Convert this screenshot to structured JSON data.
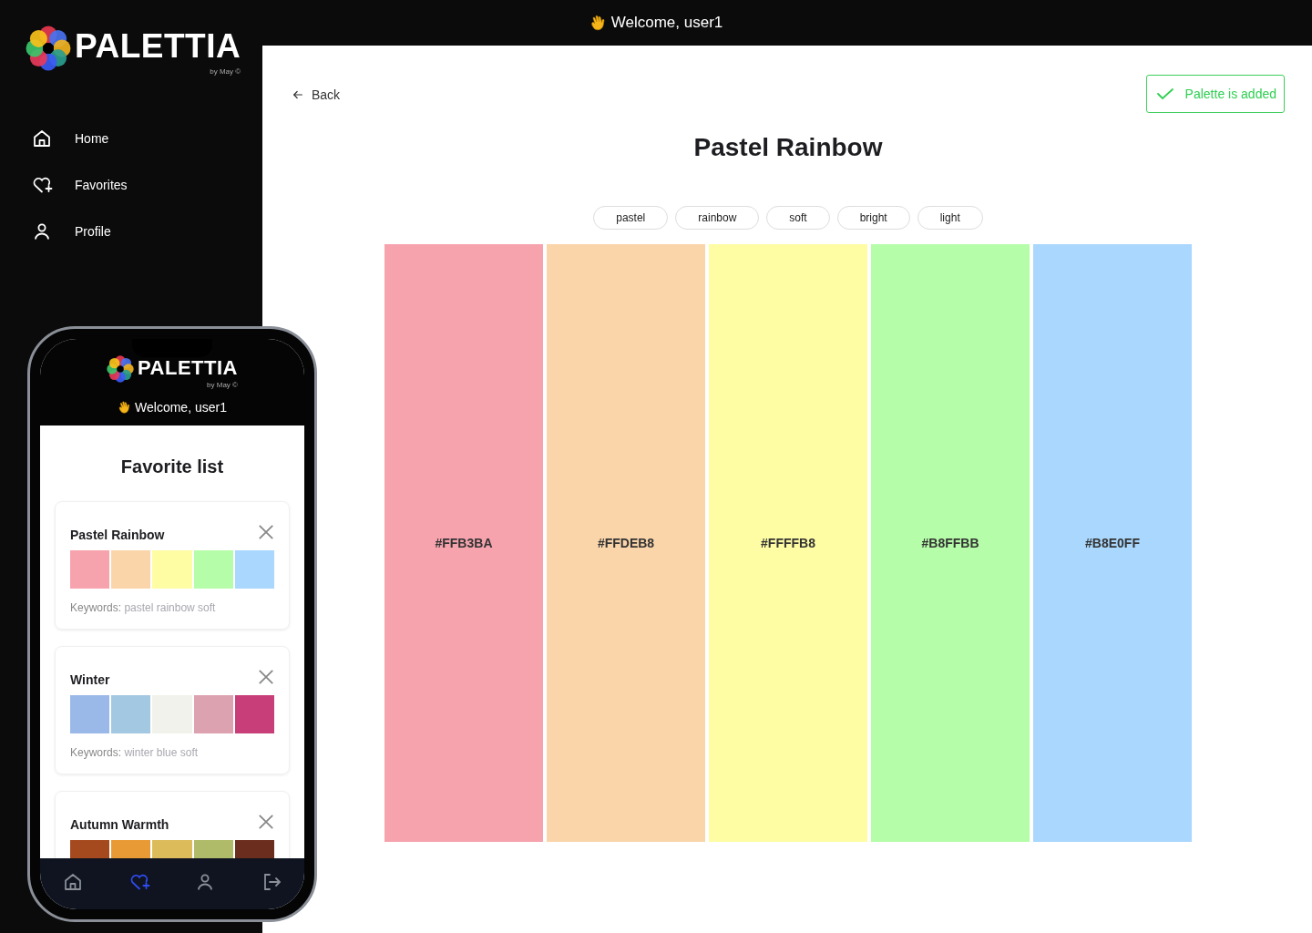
{
  "brand": {
    "name": "PALETTIA",
    "byline": "by May ©"
  },
  "sidebar": {
    "items": [
      {
        "label": "Home",
        "selected": false
      },
      {
        "label": "Favorites",
        "selected": false
      },
      {
        "label": "Profile",
        "selected": false
      }
    ]
  },
  "topbar": {
    "welcome": "Welcome, user1"
  },
  "main": {
    "back": "Back",
    "toast": "Palette is added",
    "title": "Pastel Rainbow",
    "tags": [
      "pastel",
      "rainbow",
      "soft",
      "bright",
      "light"
    ],
    "swatches": [
      {
        "hex": "#FFB3BA",
        "color": "#f7a3ae"
      },
      {
        "hex": "#FFDEB8",
        "color": "#fad5aa"
      },
      {
        "hex": "#FFFFB8",
        "color": "#fefda4"
      },
      {
        "hex": "#B8FFBB",
        "color": "#b5fda8"
      },
      {
        "hex": "#B8E0FF",
        "color": "#a9d7fd"
      }
    ]
  },
  "phone": {
    "brand": "PALETTIA",
    "byline": "by May ©",
    "welcome": "Welcome, user1",
    "title": "Favorite list",
    "cards": [
      {
        "name": "Pastel Rainbow",
        "keywords_label": "Keywords:",
        "keywords": "pastel rainbow soft",
        "swatches": [
          {
            "color": "#f7a3ae"
          },
          {
            "color": "#fad5aa"
          },
          {
            "color": "#fefda4"
          },
          {
            "color": "#b5fda8"
          },
          {
            "color": "#a9d7fd"
          }
        ]
      },
      {
        "name": "Winter",
        "keywords_label": "Keywords:",
        "keywords": "winter blue soft",
        "swatches": [
          {
            "color": "#9ab8e8"
          },
          {
            "color": "#a3c8e2"
          },
          {
            "color": "#f2f2ec"
          },
          {
            "color": "#dda2b0"
          },
          {
            "color": "#c83e78"
          }
        ]
      },
      {
        "name": "Autumn Warmth",
        "swatches": [
          {
            "color": "#a5491f"
          },
          {
            "color": "#e89a35"
          },
          {
            "color": "#dbbb5a"
          },
          {
            "color": "#afbb68"
          },
          {
            "color": "#6a2d1e"
          }
        ]
      }
    ],
    "nav": [
      {
        "selected": false
      },
      {
        "selected": true
      },
      {
        "selected": false
      },
      {
        "selected": false
      }
    ]
  }
}
